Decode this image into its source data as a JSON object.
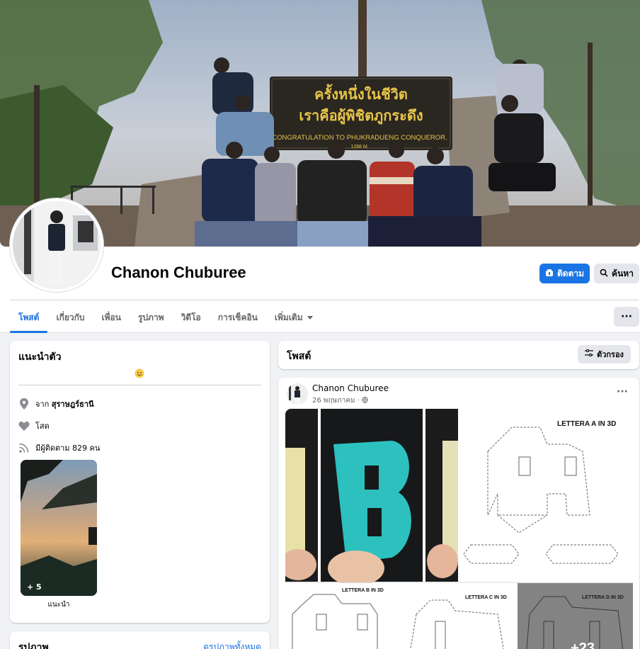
{
  "cover": {
    "sign_line1": "ครั้งหนึ่งในชีวิต",
    "sign_line2": "เราคือผู้พิชิตภูกระดึง",
    "sign_line3": "CONGRATULATION TO PHUKRADUENG CONQUEROR.",
    "sign_line4": "1288 M."
  },
  "profile": {
    "name": "Chanon Chuburee"
  },
  "actions": {
    "follow_label": "ติดตาม",
    "search_label": "ค้นหา"
  },
  "tabs": [
    {
      "label": "โพสต์"
    },
    {
      "label": "เกี่ยวกับ"
    },
    {
      "label": "เพื่อน"
    },
    {
      "label": "รูปภาพ"
    },
    {
      "label": "วิดีโอ"
    },
    {
      "label": "การเช็คอิน"
    },
    {
      "label": "เพิ่มเติม"
    }
  ],
  "tab_more": "···",
  "intro": {
    "title": "แนะนำตัว",
    "from_prefix": "จาก",
    "from_value": "สุราษฎร์ธานี",
    "relationship": "โสด",
    "followers": "มีผู้ติดตาม 829 คน",
    "featured_count": "+ 5",
    "featured_label": "แนะนำ"
  },
  "photos": {
    "title": "รูปภาพ",
    "see_all": "ดูรูปภาพทั้งหมด"
  },
  "posts": {
    "title": "โพสต์",
    "filter_label": "ตัวกรอง"
  },
  "post": {
    "author": "Chanon Chuburee",
    "date": "26 พฤษภาคม ·",
    "more": "···",
    "img_label_a": "LETTERA A IN 3D",
    "img_label_b": "LETTERA B IN 3D",
    "img_label_c": "LETTERA C IN 3D",
    "img_label_d": "LETTERA D IN 3D",
    "extra_count": "+23"
  },
  "colors": {
    "accent": "#1b74e4",
    "background": "#f0f2f5",
    "card": "#ffffff",
    "secondary_text": "#65676b"
  }
}
